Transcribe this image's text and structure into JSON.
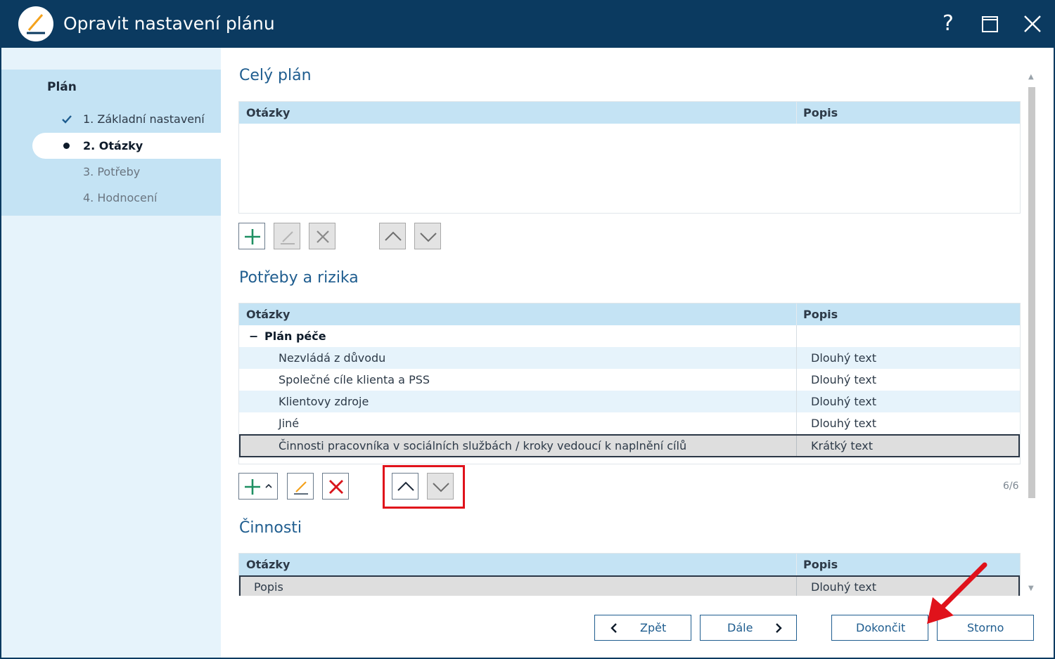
{
  "window": {
    "title": "Opravit nastavení plánu",
    "help_label": "?"
  },
  "sidebar": {
    "heading": "Plán",
    "items": [
      {
        "label": "1. Základní nastavení",
        "state": "done"
      },
      {
        "label": "2. Otázky",
        "state": "active"
      },
      {
        "label": "3. Potřeby",
        "state": "pending"
      },
      {
        "label": "4. Hodnocení",
        "state": "pending"
      }
    ]
  },
  "sections": {
    "whole_plan": {
      "title": "Celý plán",
      "col_questions": "Otázky",
      "col_description": "Popis"
    },
    "needs_risks": {
      "title": "Potřeby a rizika",
      "col_questions": "Otázky",
      "col_description": "Popis",
      "group_toggle": "−",
      "group_label": "Plán péče",
      "rows": [
        {
          "question": "Nezvládá z důvodu",
          "description": "Dlouhý text"
        },
        {
          "question": "Společné cíle klienta a PSS",
          "description": "Dlouhý text"
        },
        {
          "question": "Klientovy zdroje",
          "description": "Dlouhý text"
        },
        {
          "question": "Jiné",
          "description": "Dlouhý text"
        },
        {
          "question": "Činnosti pracovníka v sociálních službách / kroky vedoucí k naplnění cílů",
          "description": "Krátký text"
        }
      ],
      "counter": "6/6"
    },
    "activities": {
      "title": "Činnosti",
      "col_questions": "Otázky",
      "col_description": "Popis",
      "rows": [
        {
          "question": "Popis",
          "description": "Dlouhý text"
        }
      ]
    }
  },
  "footer": {
    "back_label": "Zpět",
    "next_label": "Dále",
    "finish_label": "Dokončit",
    "cancel_label": "Storno"
  },
  "colors": {
    "titlebar": "#0b3a60",
    "accent": "#1f5d8f",
    "header_row": "#c4e3f4",
    "highlight": "#e0121b",
    "add_green": "#1e8f62",
    "delete_red": "#d9141b"
  }
}
